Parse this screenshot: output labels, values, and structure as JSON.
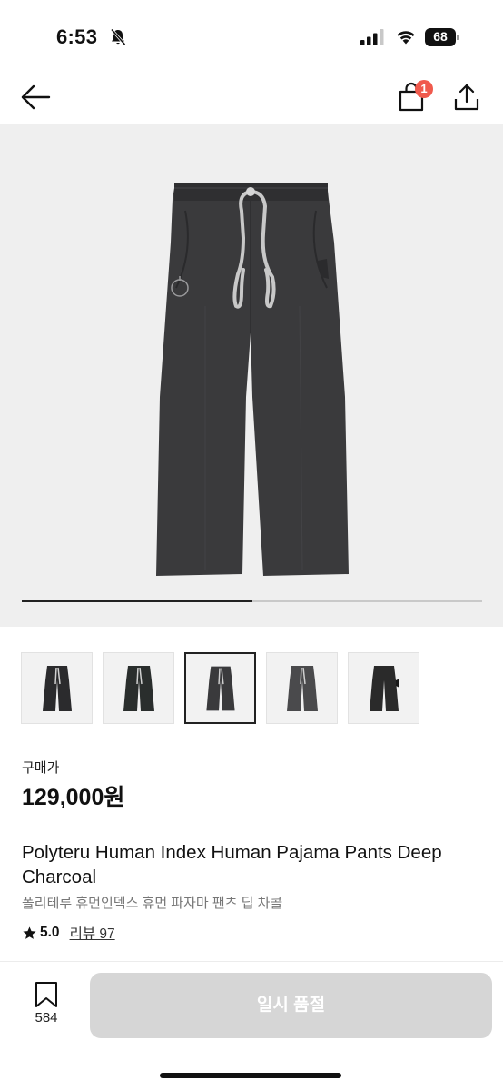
{
  "status_bar": {
    "time": "6:53",
    "battery": "68",
    "icons": [
      "bell-slash-icon",
      "signal-icon",
      "wifi-icon",
      "battery-icon"
    ]
  },
  "header": {
    "icons": [
      "back-arrow-icon",
      "shopping-bag-icon",
      "share-icon"
    ],
    "cart_count": "1",
    "badge_color": "#f05a4d"
  },
  "gallery": {
    "image_count": 5,
    "selected_index": 2,
    "progress_fraction": 0.5,
    "background_color": "#efefef",
    "product_color": "#3a3a3c"
  },
  "product": {
    "price_label": "구매가",
    "price": "129,000원",
    "title_en": "Polyteru Human Index Human Pajama Pants Deep Charcoal",
    "title_ko": "폴리테루 휴먼인덱스 휴먼 파자마 팬츠 딥 차콜",
    "rating": "5.0",
    "review_label": "리뷰 97"
  },
  "bottom_bar": {
    "bookmark_count": "584",
    "button_label": "일시 품절",
    "button_color": "#d6d6d6"
  }
}
